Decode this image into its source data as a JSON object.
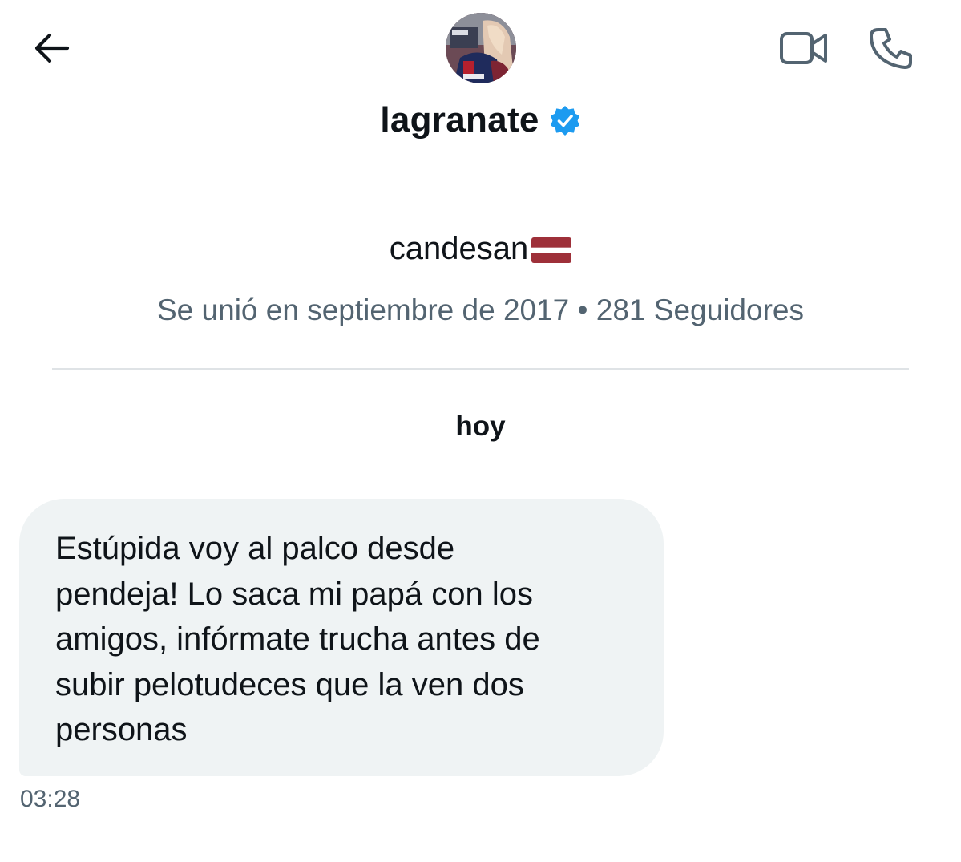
{
  "header": {
    "back_icon": "arrow-left-icon",
    "avatar_icon": "avatar-image",
    "video_icon": "video-camera-icon",
    "call_icon": "phone-icon",
    "username": "lagranate",
    "verified_icon": "verified-badge-icon",
    "verified_color": "#1d9bf0"
  },
  "profile": {
    "display_name": "candesan",
    "flag_icon": "latvia-flag-emoji",
    "meta": "Se unió en septiembre de 2017 • 281 Seguidores"
  },
  "conversation": {
    "date_separator": "hoy",
    "messages": [
      {
        "text": "Estúpida voy al palco desde\npendeja! Lo saca mi papá con los\namigos, infórmate trucha antes de\nsubir pelotudeces que la ven dos\npersonas",
        "time": "03:28"
      }
    ]
  },
  "colors": {
    "text": "#0f1419",
    "secondary_text": "#536471",
    "bubble_bg": "#eff3f4",
    "divider": "#dfe3e6",
    "flag_red": "#9e3039",
    "icon_gray": "#536471"
  }
}
